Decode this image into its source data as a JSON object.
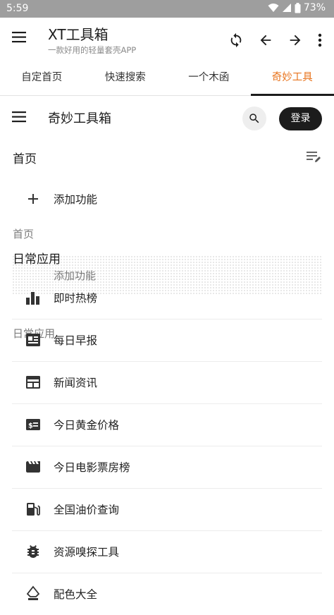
{
  "status": {
    "time": "5:59",
    "battery": "73%"
  },
  "app": {
    "title": "XT工具箱",
    "subtitle": "一款好用的轻量套壳APP"
  },
  "tabs": [
    {
      "label": "自定首页",
      "active": false
    },
    {
      "label": "快速搜索",
      "active": false
    },
    {
      "label": "一个木函",
      "active": false
    },
    {
      "label": "奇妙工具",
      "active": true
    }
  ],
  "inner": {
    "title": "奇妙工具箱",
    "login_label": "登录"
  },
  "home": {
    "title": "首页",
    "add_label": "添加功能"
  },
  "daily": {
    "title": "日常应用",
    "items": [
      {
        "label": "即时热榜",
        "icon": "bar-chart-icon"
      },
      {
        "label": "每日早报",
        "icon": "newspaper-icon"
      },
      {
        "label": "新闻资讯",
        "icon": "web-news-icon"
      },
      {
        "label": "今日黄金价格",
        "icon": "price-tag-icon"
      },
      {
        "label": "今日电影票房榜",
        "icon": "movie-icon"
      },
      {
        "label": "全国油价查询",
        "icon": "gas-station-icon"
      },
      {
        "label": "资源嗅探工具",
        "icon": "bug-icon"
      },
      {
        "label": "配色大全",
        "icon": "palette-icon"
      }
    ]
  },
  "ghost": {
    "home": "首页",
    "add": "添加功能",
    "daily": "日常应用"
  },
  "colors": {
    "accent": "#e8741e",
    "dark": "#1c1c1c",
    "status_bar": "#9e9e9e"
  }
}
